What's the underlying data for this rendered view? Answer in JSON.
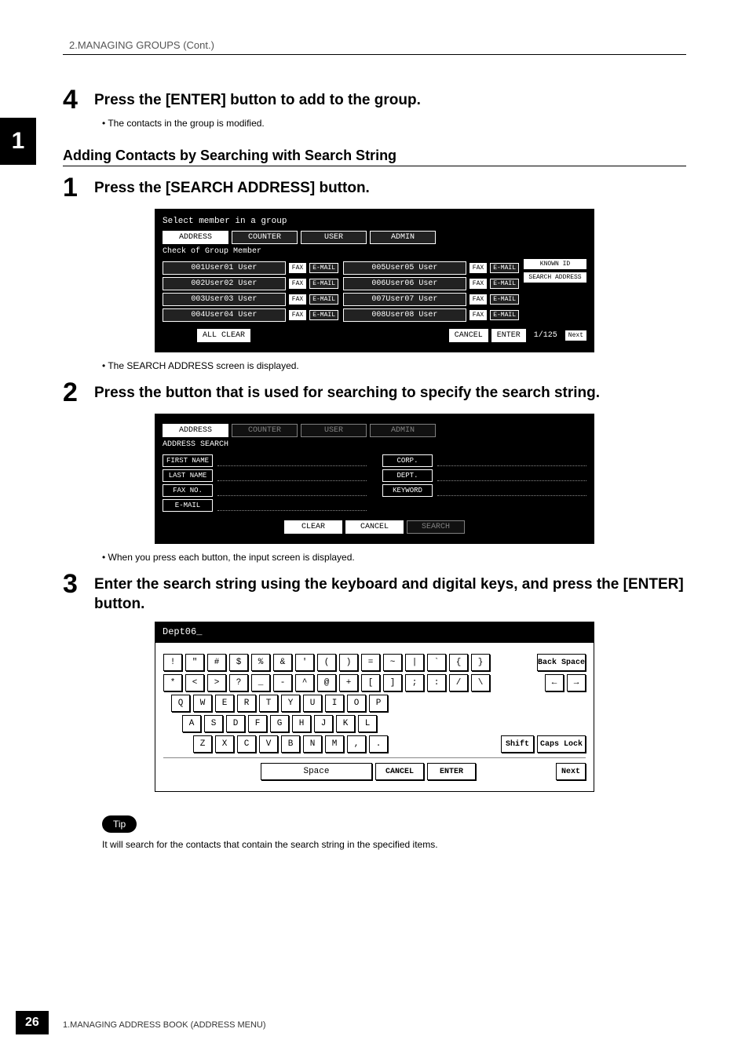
{
  "header": "2.MANAGING GROUPS (Cont.)",
  "side_tab": "1",
  "step4": {
    "num": "4",
    "title": "Press the [ENTER] button to add to the group.",
    "bullet": "The contacts in the group is modified."
  },
  "section_heading": "Adding Contacts by Searching with Search String",
  "step1": {
    "num": "1",
    "title": "Press the [SEARCH ADDRESS] button.",
    "bullet_after": "The SEARCH ADDRESS screen is displayed."
  },
  "screen1": {
    "top_text": "Select member in a group",
    "tabs": [
      "ADDRESS",
      "COUNTER",
      "USER",
      "ADMIN"
    ],
    "subtitle": "Check of Group Member",
    "side_buttons": [
      "KNOWN ID",
      "SEARCH ADDRESS"
    ],
    "rows_left": [
      {
        "id": "001",
        "name": "User01 User"
      },
      {
        "id": "002",
        "name": "User02 User"
      },
      {
        "id": "003",
        "name": "User03 User"
      },
      {
        "id": "004",
        "name": "User04 User"
      }
    ],
    "rows_right": [
      {
        "id": "005",
        "name": "User05 User"
      },
      {
        "id": "006",
        "name": "User06 User"
      },
      {
        "id": "007",
        "name": "User07 User"
      },
      {
        "id": "008",
        "name": "User08 User"
      }
    ],
    "tag_fax": "FAX",
    "tag_email": "E-MAIL",
    "bottom": {
      "all_clear": "ALL CLEAR",
      "cancel": "CANCEL",
      "enter": "ENTER",
      "page": "1/125",
      "next": "Next"
    }
  },
  "step2": {
    "num": "2",
    "title": "Press the button that is used for searching to specify the search string.",
    "bullet_after": "When you press each button, the input screen is displayed."
  },
  "screen2": {
    "tabs": [
      "ADDRESS",
      "COUNTER",
      "USER",
      "ADMIN"
    ],
    "subtitle": "ADDRESS SEARCH",
    "fields_left": [
      "FIRST NAME",
      "LAST NAME",
      "FAX NO.",
      "E-MAIL"
    ],
    "fields_right": [
      "CORP.",
      "DEPT.",
      "KEYWORD"
    ],
    "bottom": {
      "clear": "CLEAR",
      "cancel": "CANCEL",
      "search": "SEARCH"
    }
  },
  "step3": {
    "num": "3",
    "title": "Enter the search string using the keyboard and digital keys, and press the [ENTER] button."
  },
  "keyboard": {
    "input_value": "Dept06_",
    "row1": [
      "!",
      "\"",
      "#",
      "$",
      "%",
      "&",
      "'",
      "(",
      ")",
      "=",
      "~",
      "|",
      "`",
      "{",
      "}"
    ],
    "row1_end": "Back Space",
    "row2": [
      "*",
      "<",
      ">",
      "?",
      "_",
      "-",
      "^",
      "@",
      "+",
      "[",
      "]",
      ";",
      ":",
      "/",
      "\\"
    ],
    "row2_left": "←",
    "row2_right": "→",
    "row3": [
      "Q",
      "W",
      "E",
      "R",
      "T",
      "Y",
      "U",
      "I",
      "O",
      "P"
    ],
    "row4": [
      "A",
      "S",
      "D",
      "F",
      "G",
      "H",
      "J",
      "K",
      "L"
    ],
    "row5": [
      "Z",
      "X",
      "C",
      "V",
      "B",
      "N",
      "M",
      ",",
      "."
    ],
    "shift": "Shift",
    "caps": "Caps Lock",
    "space": "Space",
    "cancel": "CANCEL",
    "enter": "ENTER",
    "next": "Next"
  },
  "tip": {
    "label": "Tip",
    "text": "It will search for the contacts that contain the search string in the specified items."
  },
  "footer": {
    "page_num": "26",
    "text": "1.MANAGING ADDRESS BOOK (ADDRESS MENU)"
  }
}
